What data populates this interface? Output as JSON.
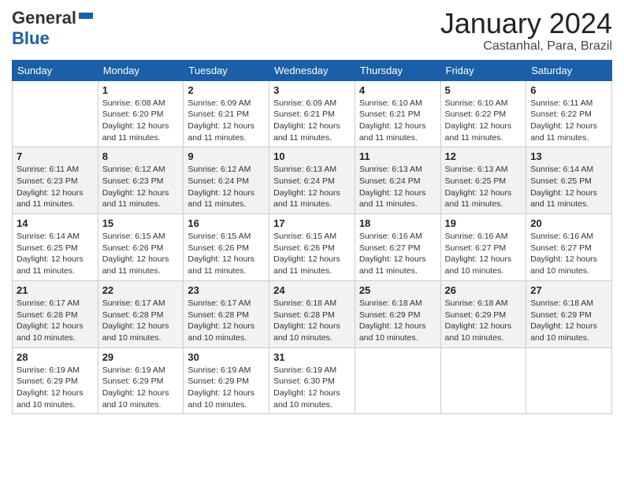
{
  "header": {
    "logo_general": "General",
    "logo_blue": "Blue",
    "month_title": "January 2024",
    "location": "Castanhal, Para, Brazil"
  },
  "days_of_week": [
    "Sunday",
    "Monday",
    "Tuesday",
    "Wednesday",
    "Thursday",
    "Friday",
    "Saturday"
  ],
  "weeks": [
    [
      {
        "day": "",
        "sunrise": "",
        "sunset": "",
        "daylight": ""
      },
      {
        "day": "1",
        "sunrise": "Sunrise: 6:08 AM",
        "sunset": "Sunset: 6:20 PM",
        "daylight": "Daylight: 12 hours and 11 minutes."
      },
      {
        "day": "2",
        "sunrise": "Sunrise: 6:09 AM",
        "sunset": "Sunset: 6:21 PM",
        "daylight": "Daylight: 12 hours and 11 minutes."
      },
      {
        "day": "3",
        "sunrise": "Sunrise: 6:09 AM",
        "sunset": "Sunset: 6:21 PM",
        "daylight": "Daylight: 12 hours and 11 minutes."
      },
      {
        "day": "4",
        "sunrise": "Sunrise: 6:10 AM",
        "sunset": "Sunset: 6:21 PM",
        "daylight": "Daylight: 12 hours and 11 minutes."
      },
      {
        "day": "5",
        "sunrise": "Sunrise: 6:10 AM",
        "sunset": "Sunset: 6:22 PM",
        "daylight": "Daylight: 12 hours and 11 minutes."
      },
      {
        "day": "6",
        "sunrise": "Sunrise: 6:11 AM",
        "sunset": "Sunset: 6:22 PM",
        "daylight": "Daylight: 12 hours and 11 minutes."
      }
    ],
    [
      {
        "day": "7",
        "sunrise": "Sunrise: 6:11 AM",
        "sunset": "Sunset: 6:23 PM",
        "daylight": "Daylight: 12 hours and 11 minutes."
      },
      {
        "day": "8",
        "sunrise": "Sunrise: 6:12 AM",
        "sunset": "Sunset: 6:23 PM",
        "daylight": "Daylight: 12 hours and 11 minutes."
      },
      {
        "day": "9",
        "sunrise": "Sunrise: 6:12 AM",
        "sunset": "Sunset: 6:24 PM",
        "daylight": "Daylight: 12 hours and 11 minutes."
      },
      {
        "day": "10",
        "sunrise": "Sunrise: 6:13 AM",
        "sunset": "Sunset: 6:24 PM",
        "daylight": "Daylight: 12 hours and 11 minutes."
      },
      {
        "day": "11",
        "sunrise": "Sunrise: 6:13 AM",
        "sunset": "Sunset: 6:24 PM",
        "daylight": "Daylight: 12 hours and 11 minutes."
      },
      {
        "day": "12",
        "sunrise": "Sunrise: 6:13 AM",
        "sunset": "Sunset: 6:25 PM",
        "daylight": "Daylight: 12 hours and 11 minutes."
      },
      {
        "day": "13",
        "sunrise": "Sunrise: 6:14 AM",
        "sunset": "Sunset: 6:25 PM",
        "daylight": "Daylight: 12 hours and 11 minutes."
      }
    ],
    [
      {
        "day": "14",
        "sunrise": "Sunrise: 6:14 AM",
        "sunset": "Sunset: 6:25 PM",
        "daylight": "Daylight: 12 hours and 11 minutes."
      },
      {
        "day": "15",
        "sunrise": "Sunrise: 6:15 AM",
        "sunset": "Sunset: 6:26 PM",
        "daylight": "Daylight: 12 hours and 11 minutes."
      },
      {
        "day": "16",
        "sunrise": "Sunrise: 6:15 AM",
        "sunset": "Sunset: 6:26 PM",
        "daylight": "Daylight: 12 hours and 11 minutes."
      },
      {
        "day": "17",
        "sunrise": "Sunrise: 6:15 AM",
        "sunset": "Sunset: 6:26 PM",
        "daylight": "Daylight: 12 hours and 11 minutes."
      },
      {
        "day": "18",
        "sunrise": "Sunrise: 6:16 AM",
        "sunset": "Sunset: 6:27 PM",
        "daylight": "Daylight: 12 hours and 11 minutes."
      },
      {
        "day": "19",
        "sunrise": "Sunrise: 6:16 AM",
        "sunset": "Sunset: 6:27 PM",
        "daylight": "Daylight: 12 hours and 10 minutes."
      },
      {
        "day": "20",
        "sunrise": "Sunrise: 6:16 AM",
        "sunset": "Sunset: 6:27 PM",
        "daylight": "Daylight: 12 hours and 10 minutes."
      }
    ],
    [
      {
        "day": "21",
        "sunrise": "Sunrise: 6:17 AM",
        "sunset": "Sunset: 6:28 PM",
        "daylight": "Daylight: 12 hours and 10 minutes."
      },
      {
        "day": "22",
        "sunrise": "Sunrise: 6:17 AM",
        "sunset": "Sunset: 6:28 PM",
        "daylight": "Daylight: 12 hours and 10 minutes."
      },
      {
        "day": "23",
        "sunrise": "Sunrise: 6:17 AM",
        "sunset": "Sunset: 6:28 PM",
        "daylight": "Daylight: 12 hours and 10 minutes."
      },
      {
        "day": "24",
        "sunrise": "Sunrise: 6:18 AM",
        "sunset": "Sunset: 6:28 PM",
        "daylight": "Daylight: 12 hours and 10 minutes."
      },
      {
        "day": "25",
        "sunrise": "Sunrise: 6:18 AM",
        "sunset": "Sunset: 6:29 PM",
        "daylight": "Daylight: 12 hours and 10 minutes."
      },
      {
        "day": "26",
        "sunrise": "Sunrise: 6:18 AM",
        "sunset": "Sunset: 6:29 PM",
        "daylight": "Daylight: 12 hours and 10 minutes."
      },
      {
        "day": "27",
        "sunrise": "Sunrise: 6:18 AM",
        "sunset": "Sunset: 6:29 PM",
        "daylight": "Daylight: 12 hours and 10 minutes."
      }
    ],
    [
      {
        "day": "28",
        "sunrise": "Sunrise: 6:19 AM",
        "sunset": "Sunset: 6:29 PM",
        "daylight": "Daylight: 12 hours and 10 minutes."
      },
      {
        "day": "29",
        "sunrise": "Sunrise: 6:19 AM",
        "sunset": "Sunset: 6:29 PM",
        "daylight": "Daylight: 12 hours and 10 minutes."
      },
      {
        "day": "30",
        "sunrise": "Sunrise: 6:19 AM",
        "sunset": "Sunset: 6:29 PM",
        "daylight": "Daylight: 12 hours and 10 minutes."
      },
      {
        "day": "31",
        "sunrise": "Sunrise: 6:19 AM",
        "sunset": "Sunset: 6:30 PM",
        "daylight": "Daylight: 12 hours and 10 minutes."
      },
      {
        "day": "",
        "sunrise": "",
        "sunset": "",
        "daylight": ""
      },
      {
        "day": "",
        "sunrise": "",
        "sunset": "",
        "daylight": ""
      },
      {
        "day": "",
        "sunrise": "",
        "sunset": "",
        "daylight": ""
      }
    ]
  ]
}
